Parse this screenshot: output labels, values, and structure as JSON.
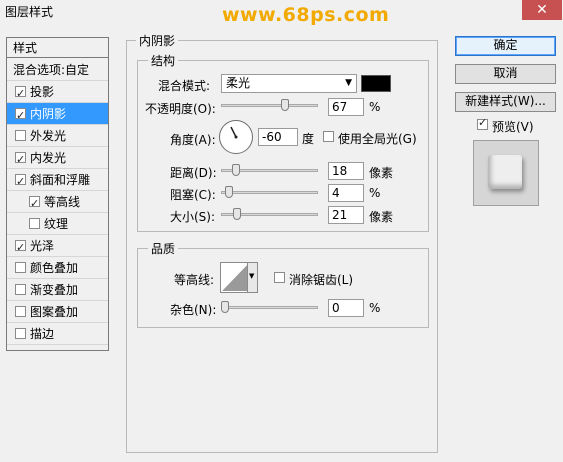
{
  "window": {
    "title": "图层样式",
    "watermark": "www.68ps.com",
    "close_glyph": "✕"
  },
  "styles_panel": {
    "header": "样式",
    "items": [
      {
        "label": "混合选项:自定",
        "checkbox": false,
        "checked": false
      },
      {
        "label": "投影",
        "checkbox": true,
        "checked": true
      },
      {
        "label": "内阴影",
        "checkbox": true,
        "checked": true,
        "selected": true
      },
      {
        "label": "外发光",
        "checkbox": true,
        "checked": false
      },
      {
        "label": "内发光",
        "checkbox": true,
        "checked": true
      },
      {
        "label": "斜面和浮雕",
        "checkbox": true,
        "checked": true
      },
      {
        "label": "等高线",
        "checkbox": true,
        "checked": true,
        "indent": true
      },
      {
        "label": "纹理",
        "checkbox": true,
        "checked": false,
        "indent": true
      },
      {
        "label": "光泽",
        "checkbox": true,
        "checked": true
      },
      {
        "label": "颜色叠加",
        "checkbox": true,
        "checked": false
      },
      {
        "label": "渐变叠加",
        "checkbox": true,
        "checked": false
      },
      {
        "label": "图案叠加",
        "checkbox": true,
        "checked": false
      },
      {
        "label": "描边",
        "checkbox": true,
        "checked": false
      }
    ]
  },
  "inner_shadow": {
    "section_title": "内阴影",
    "structure": {
      "title": "结构",
      "blend_mode_label": "混合模式:",
      "blend_mode_value": "柔光",
      "shadow_color": "#000000",
      "opacity_label": "不透明度(O):",
      "opacity_value": "67",
      "opacity_unit": "%",
      "opacity_fraction": 0.67,
      "angle_label": "角度(A):",
      "angle_value": "-60",
      "angle_unit": "度",
      "global_light_label": "使用全局光(G)",
      "distance_label": "距离(D):",
      "distance_value": "18",
      "distance_unit": "像素",
      "distance_fraction": 0.12,
      "choke_label": "阻塞(C):",
      "choke_value": "4",
      "choke_unit": "%",
      "choke_fraction": 0.04,
      "size_label": "大小(S):",
      "size_value": "21",
      "size_unit": "像素",
      "size_fraction": 0.14
    },
    "quality": {
      "title": "品质",
      "contour_label": "等高线:",
      "anti_alias_label": "消除锯齿(L)",
      "noise_label": "杂色(N):",
      "noise_value": "0",
      "noise_unit": "%",
      "noise_fraction": 0.0
    }
  },
  "buttons": {
    "ok": "确定",
    "cancel": "取消",
    "new_style": "新建样式(W)...",
    "preview_label": "预览(V)"
  }
}
